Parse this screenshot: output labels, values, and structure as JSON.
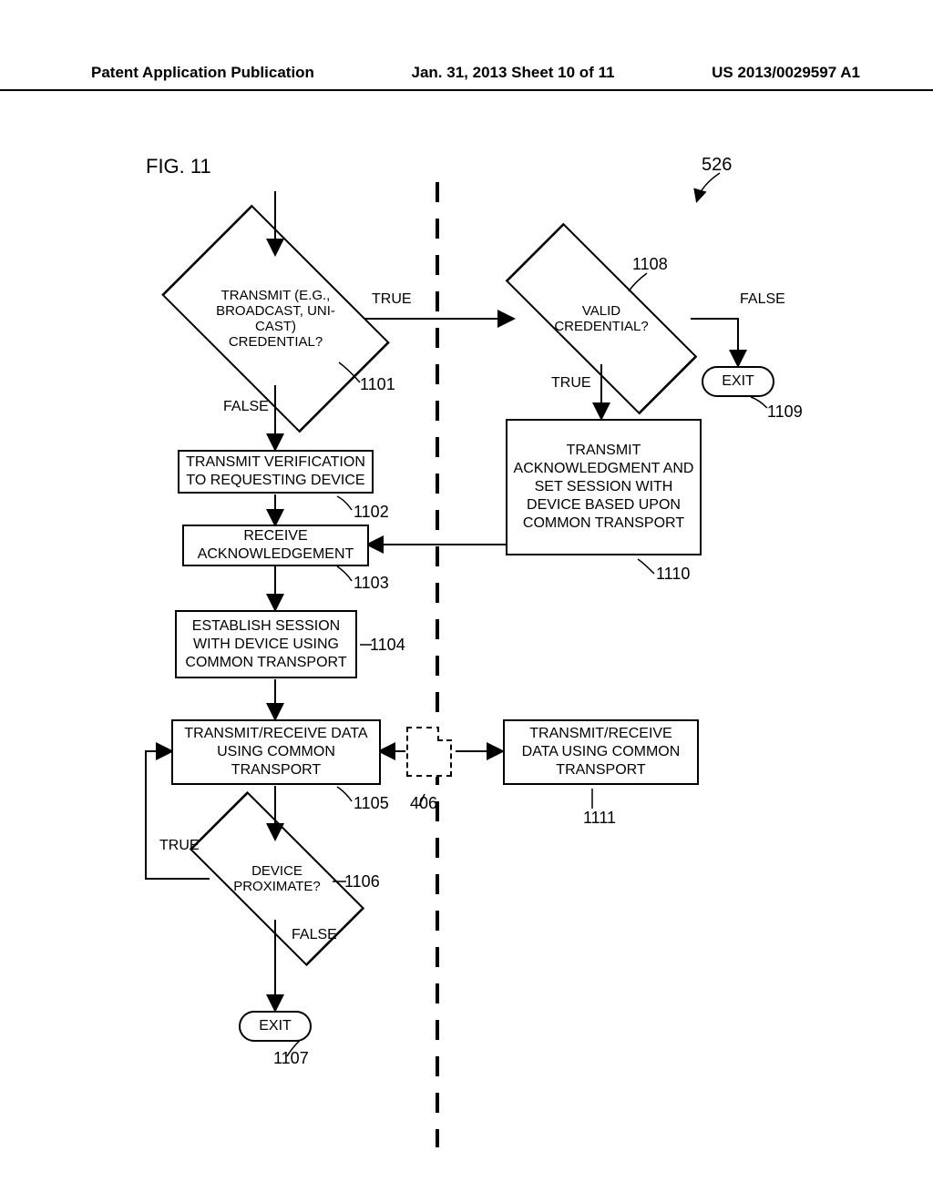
{
  "header": {
    "left": "Patent Application Publication",
    "center": "Jan. 31, 2013  Sheet 10 of 11",
    "right": "US 2013/0029597 A1"
  },
  "figure": {
    "label": "FIG. 11",
    "topref": "526"
  },
  "nodes": {
    "d1101": "TRANSMIT (E.G., BROADCAST, UNI-CAST) CREDENTIAL?",
    "b1102": "TRANSMIT VERIFICATION TO REQUESTING DEVICE",
    "b1103": "RECEIVE ACKNOWLEDGEMENT",
    "b1104": "ESTABLISH SESSION WITH DEVICE USING COMMON TRANSPORT",
    "b1105": "TRANSMIT/RECEIVE DATA USING COMMON TRANSPORT",
    "d1106": "DEVICE PROXIMATE?",
    "t1107": "EXIT",
    "d1108": "VALID CREDENTIAL?",
    "t1109": "EXIT",
    "b1110": "TRANSMIT ACKNOWLEDGMENT AND SET SESSION WITH DEVICE BASED UPON COMMON TRANSPORT",
    "b1111": "TRANSMIT/RECEIVE DATA USING COMMON TRANSPORT"
  },
  "labels": {
    "true": "TRUE",
    "false": "FALSE"
  },
  "refs": {
    "r1101": "1101",
    "r1102": "1102",
    "r1103": "1103",
    "r1104": "1104",
    "r1105": "1105",
    "r1106": "1106",
    "r1107": "1107",
    "r1108": "1108",
    "r1109": "1109",
    "r1110": "1110",
    "r1111": "1111",
    "r406": "406"
  }
}
